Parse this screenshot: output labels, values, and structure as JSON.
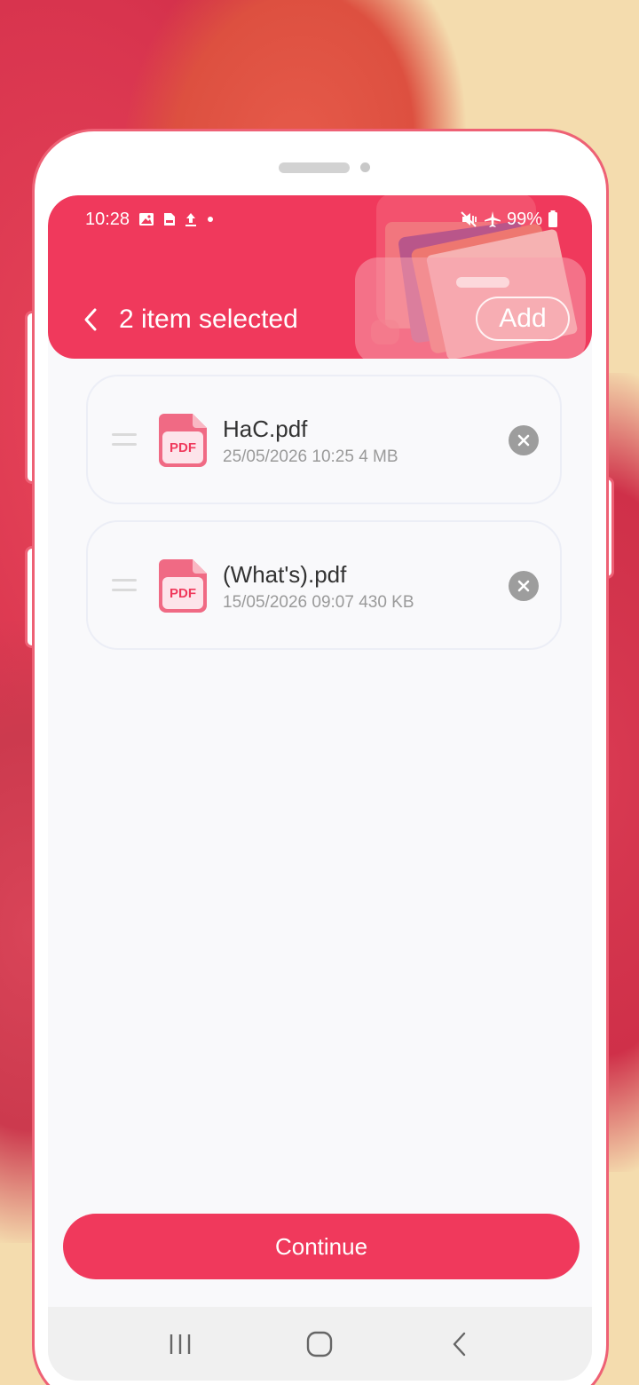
{
  "status_bar": {
    "time": "10:28",
    "battery": "99%",
    "left_icons": [
      "image-icon",
      "pdf-icon",
      "upload-icon",
      "dot-icon"
    ],
    "right_icons": [
      "mute-vibrate-icon",
      "airplane-icon",
      "battery-icon"
    ]
  },
  "header": {
    "title": "2 item selected",
    "add_label": "Add",
    "back_icon": "chevron-left-icon",
    "background_color": "#f0395c"
  },
  "files": [
    {
      "name": "HaC.pdf",
      "meta": "25/05/2026 10:25 4 MB",
      "icon": "pdf-file-icon",
      "icon_label": "PDF"
    },
    {
      "name": "(What's).pdf",
      "meta": "15/05/2026 09:07 430 KB",
      "icon": "pdf-file-icon",
      "icon_label": "PDF"
    }
  ],
  "footer": {
    "continue_label": "Continue",
    "accent_color": "#f0395c"
  },
  "nav_bar": {
    "buttons": [
      "recent-apps-icon",
      "home-icon",
      "back-icon"
    ]
  }
}
